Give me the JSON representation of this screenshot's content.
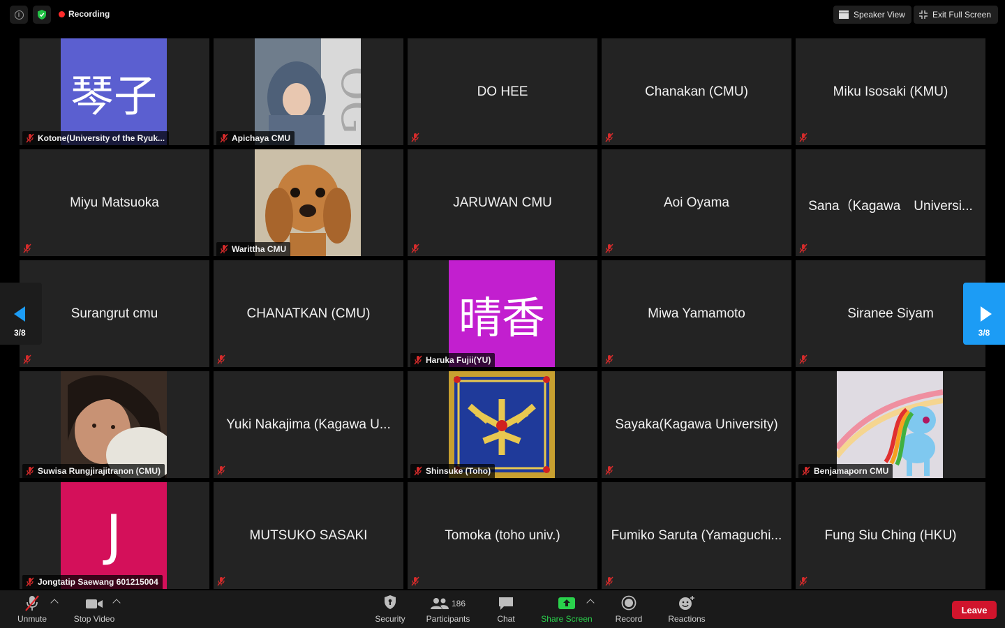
{
  "topbar": {
    "recording_label": "Recording",
    "speaker_view_label": "Speaker View",
    "exit_fullscreen_label": "Exit Full Screen"
  },
  "paging": {
    "left_label": "3/8",
    "right_label": "3/8"
  },
  "tiles": [
    {
      "name": "Kotone(University of the Ryuk...",
      "avatar": "kanji",
      "avatar_text": "琴子",
      "avatar_color": "#5b5fd0"
    },
    {
      "name": "Apichaya CMU",
      "avatar": "photo-magazine"
    },
    {
      "name": "DO HEE",
      "avatar": "none"
    },
    {
      "name": "Chanakan (CMU)",
      "avatar": "none"
    },
    {
      "name": "Miku Isosaki (KMU)",
      "avatar": "none"
    },
    {
      "name": "Miyu Matsuoka",
      "avatar": "none"
    },
    {
      "name": "Warittha CMU",
      "avatar": "photo-dog"
    },
    {
      "name": "JARUWAN CMU",
      "avatar": "none"
    },
    {
      "name": "Aoi Oyama",
      "avatar": "none"
    },
    {
      "name": "Sana（Kagawa　Universi...",
      "avatar": "none"
    },
    {
      "name": "Surangrut cmu",
      "avatar": "none"
    },
    {
      "name": "CHANATKAN (CMU)",
      "avatar": "none"
    },
    {
      "name": "Haruka Fujii(YU)",
      "avatar": "kanji",
      "avatar_text": "晴香",
      "avatar_color": "#c21fcf"
    },
    {
      "name": "Miwa Yamamoto",
      "avatar": "none"
    },
    {
      "name": "Siranee Siyam",
      "avatar": "none"
    },
    {
      "name": "Suwisa Rungjirajitranon (CMU)",
      "avatar": "photo-person"
    },
    {
      "name": "Yuki Nakajima (Kagawa U...",
      "avatar": "none"
    },
    {
      "name": "Shinsuke (Toho)",
      "avatar": "photo-emblem"
    },
    {
      "name": "Sayaka(Kagawa University)",
      "avatar": "none"
    },
    {
      "name": "Benjamaporn CMU",
      "avatar": "photo-pony"
    },
    {
      "name": "Jongtatip Saewang 601215004",
      "avatar": "kanji",
      "avatar_text": "J",
      "avatar_color": "#d4105a"
    },
    {
      "name": "MUTSUKO SASAKI",
      "avatar": "none"
    },
    {
      "name": "Tomoka (toho univ.)",
      "avatar": "none"
    },
    {
      "name": "Fumiko Saruta (Yamaguchi...",
      "avatar": "none"
    },
    {
      "name": "Fung Siu Ching (HKU)",
      "avatar": "none"
    }
  ],
  "toolbar": {
    "unmute_label": "Unmute",
    "stop_video_label": "Stop Video",
    "security_label": "Security",
    "participants_label": "Participants",
    "participants_count": "186",
    "chat_label": "Chat",
    "share_screen_label": "Share Screen",
    "record_label": "Record",
    "reactions_label": "Reactions",
    "leave_label": "Leave"
  },
  "colors": {
    "accent_blue": "#1c9cf5",
    "share_green": "#2ad14c",
    "leave_red": "#d0142c",
    "recording_red": "#ff2a2a"
  }
}
